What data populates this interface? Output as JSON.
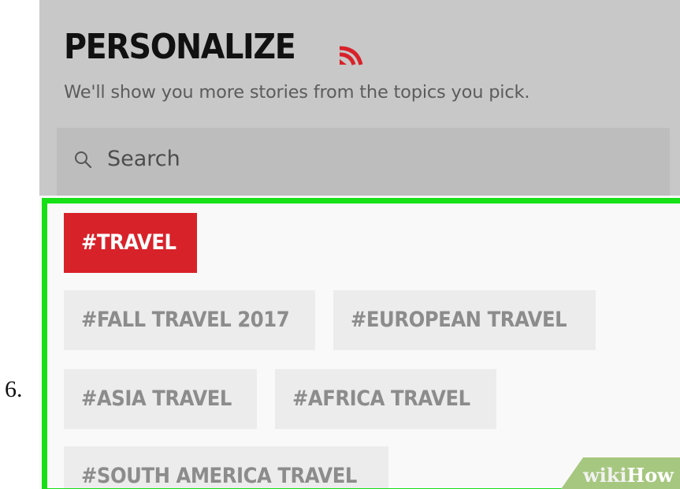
{
  "step": {
    "number": "6."
  },
  "header": {
    "title": "PERSONALIZE",
    "icon": "feed-signal-icon",
    "subtitle": "We'll show you more stories from the topics you pick."
  },
  "search": {
    "icon": "search-icon",
    "label": "Search"
  },
  "tags": [
    {
      "label": "#TRAVEL",
      "selected": true
    },
    {
      "label": "#FALL TRAVEL 2017",
      "selected": false
    },
    {
      "label": "#EUROPEAN TRAVEL",
      "selected": false
    },
    {
      "label": "#ASIA TRAVEL",
      "selected": false
    },
    {
      "label": "#AFRICA TRAVEL",
      "selected": false
    },
    {
      "label": "#SOUTH AMERICA TRAVEL",
      "selected": false
    }
  ],
  "colors": {
    "accent": "#d8222a",
    "highlight": "#16e016",
    "header_bg": "#c8c8c8"
  },
  "watermark": {
    "part1": "wiki",
    "part2": "How"
  }
}
